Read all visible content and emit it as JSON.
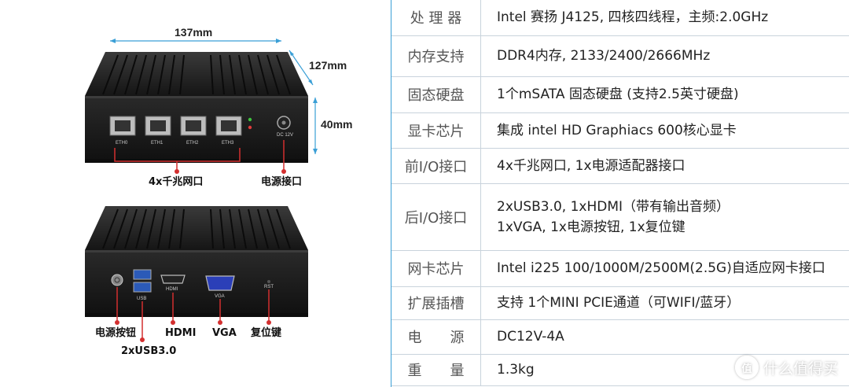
{
  "figure": {
    "dim_width": "137mm",
    "dim_depth": "127mm",
    "dim_height": "40mm",
    "front_caption_lan": "4x千兆网口",
    "front_caption_power": "电源接口",
    "port_labels": [
      "ETH0",
      "ETH1",
      "ETH2",
      "ETH3"
    ],
    "dc_label": "DC 12V",
    "rear_usb_label": "USB",
    "rear_hdmi_label": "HDMI",
    "rear_vga_label": "VGA",
    "rear_rst_label": "RST",
    "rear_caption_power_btn": "电源按钮",
    "rear_caption_hdmi": "HDMI",
    "rear_caption_vga": "VGA",
    "rear_caption_reset": "复位键",
    "rear_caption_usb": "2xUSB3.0"
  },
  "specs": [
    {
      "label": "处 理 器",
      "value": [
        "Intel 赛扬 J4125, 四核四线程，主频:2.0GHz"
      ]
    },
    {
      "label": "内存支持",
      "value": [
        "DDR4内存, 2133/2400/2666MHz"
      ]
    },
    {
      "label": "固态硬盘",
      "value": [
        "1个mSATA 固态硬盘 (支持2.5英寸硬盘)"
      ]
    },
    {
      "label": "显卡芯片",
      "value": [
        "集成 intel HD Graphiacs 600核心显卡"
      ]
    },
    {
      "label": "前I/O接口",
      "value": [
        "4x千兆网口, 1x电源适配器接口"
      ]
    },
    {
      "label": "后I/O接口",
      "value": [
        "2xUSB3.0, 1xHDMI（带有输出音频）",
        "1xVGA, 1x电源按钮, 1x复位键"
      ]
    },
    {
      "label": "网卡芯片",
      "value": [
        "Intel i225 100/1000M/2500M(2.5G)自适应网卡接口"
      ]
    },
    {
      "label": "扩展插槽",
      "value": [
        "支持 1个MINI PCIE通道（可WIFI/蓝牙）"
      ]
    },
    {
      "label": "电　　源",
      "value": [
        "DC12V-4A"
      ]
    },
    {
      "label": "重　　量",
      "value": [
        "1.3kg"
      ]
    }
  ],
  "watermark": {
    "icon": "值",
    "text": "什么值得买"
  },
  "colors": {
    "accent_blue": "#3a9fd6",
    "callout_red": "#d32f2f",
    "chassis": "#1e1e1e"
  }
}
